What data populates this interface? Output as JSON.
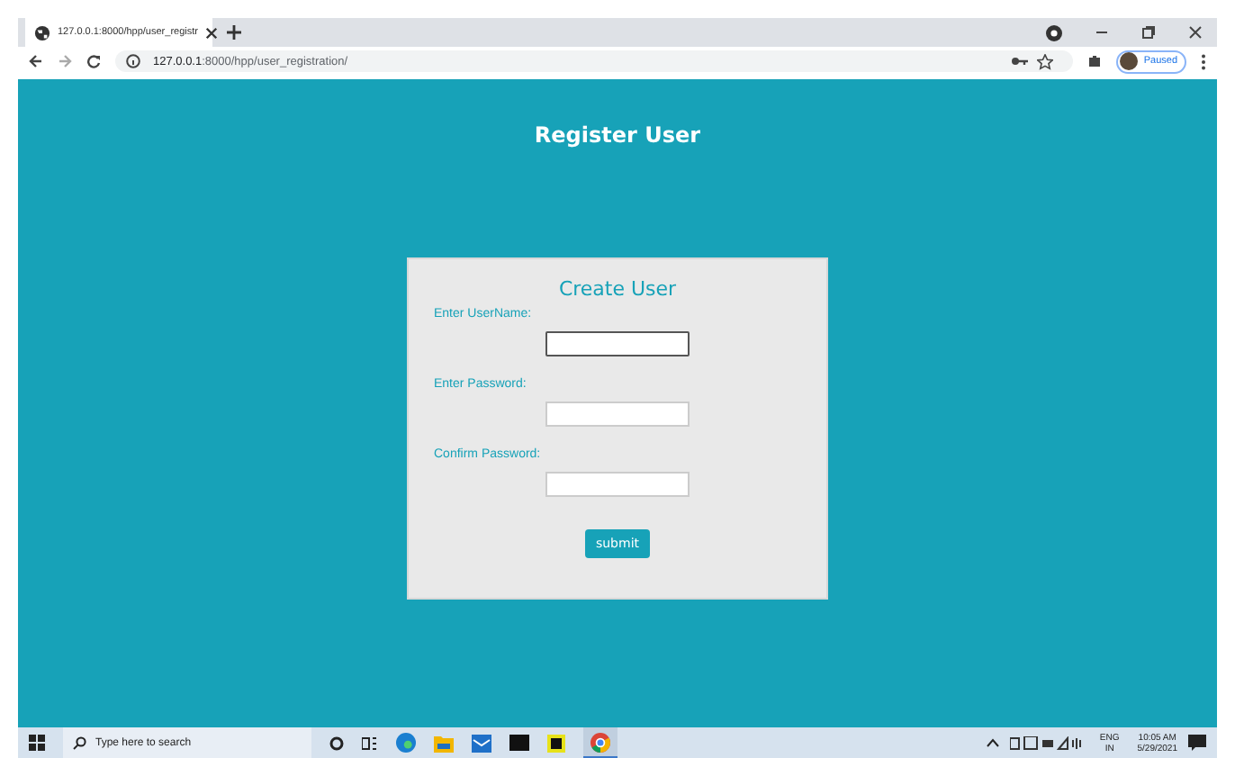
{
  "browser": {
    "tab_title": "127.0.0.1:8000/hpp/user_registr",
    "url_host": "127.0.0.1",
    "url_rest": ":8000/hpp/user_registration/",
    "profile_status": "Paused"
  },
  "page": {
    "heading": "Register User"
  },
  "form": {
    "title": "Create User",
    "fields": [
      {
        "label": "Enter UserName:",
        "focused": true
      },
      {
        "label": "Enter Password:",
        "focused": false
      },
      {
        "label": "Confirm Password:",
        "focused": false
      }
    ],
    "submit": "submit"
  },
  "taskbar": {
    "search_placeholder": "Type here to search",
    "language": "ENG",
    "region": "IN",
    "time": "10:05 AM",
    "date": "5/29/2021"
  }
}
